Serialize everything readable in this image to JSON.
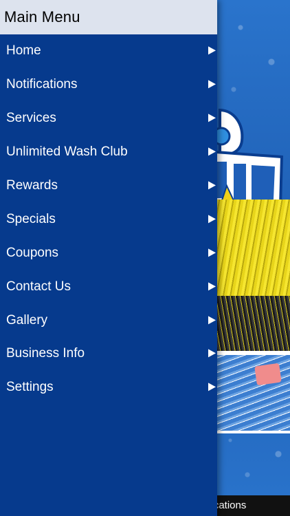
{
  "drawer": {
    "title": "Main Menu",
    "items": [
      {
        "label": "Home"
      },
      {
        "label": "Notifications"
      },
      {
        "label": "Services"
      },
      {
        "label": "Unlimited Wash Club"
      },
      {
        "label": "Rewards"
      },
      {
        "label": "Specials"
      },
      {
        "label": "Coupons"
      },
      {
        "label": "Contact Us"
      },
      {
        "label": "Gallery"
      },
      {
        "label": "Business Info"
      },
      {
        "label": "Settings"
      }
    ]
  },
  "background": {
    "tab_bar_label": "ifications"
  },
  "colors": {
    "drawer_bg": "#063a8d",
    "header_bg": "#dde3ee",
    "app_bg": "#2a74cc",
    "brush_yellow": "#e8d51a"
  }
}
